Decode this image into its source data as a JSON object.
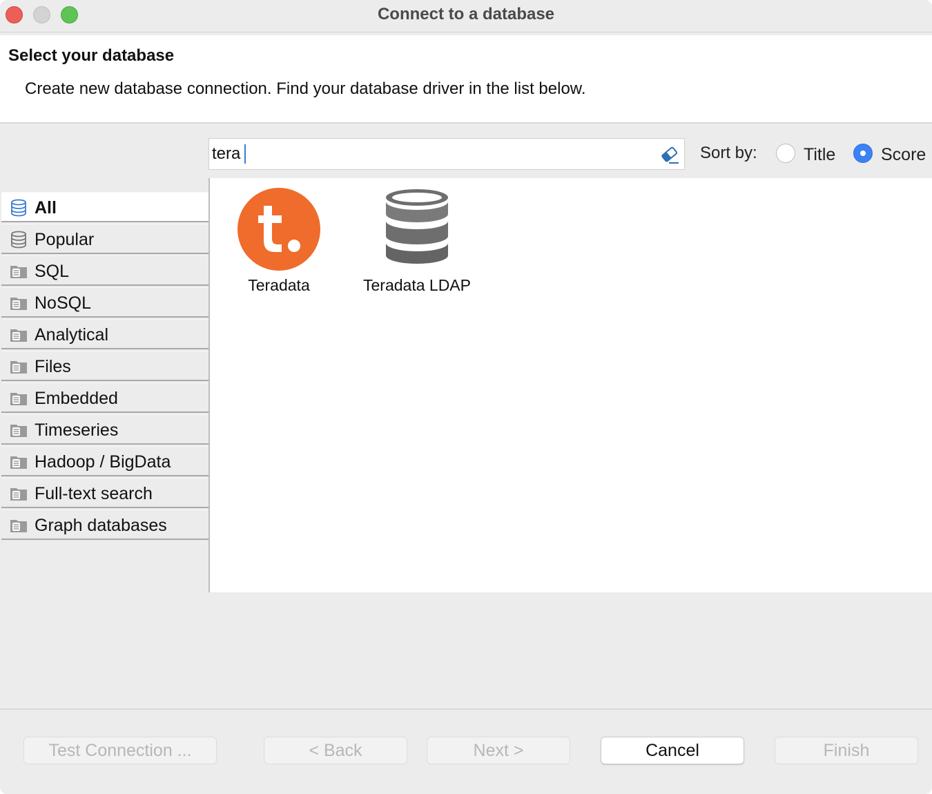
{
  "window": {
    "title": "Connect to a database"
  },
  "header": {
    "title": "Select your database",
    "description": "Create new database connection. Find your database driver in the list below."
  },
  "search": {
    "value": "tera"
  },
  "sort": {
    "label": "Sort by:",
    "options": [
      {
        "label": "Title",
        "selected": false
      },
      {
        "label": "Score",
        "selected": true
      }
    ]
  },
  "categories": [
    {
      "label": "All",
      "selected": true,
      "icon": "database-stack-icon"
    },
    {
      "label": "Popular",
      "selected": false,
      "icon": "database-stack-icon"
    },
    {
      "label": "SQL",
      "selected": false,
      "icon": "folder-database-icon"
    },
    {
      "label": "NoSQL",
      "selected": false,
      "icon": "folder-database-icon"
    },
    {
      "label": "Analytical",
      "selected": false,
      "icon": "folder-database-icon"
    },
    {
      "label": "Files",
      "selected": false,
      "icon": "folder-database-icon"
    },
    {
      "label": "Embedded",
      "selected": false,
      "icon": "folder-database-icon"
    },
    {
      "label": "Timeseries",
      "selected": false,
      "icon": "folder-database-icon"
    },
    {
      "label": "Hadoop / BigData",
      "selected": false,
      "icon": "folder-database-icon"
    },
    {
      "label": "Full-text search",
      "selected": false,
      "icon": "folder-database-icon"
    },
    {
      "label": "Graph databases",
      "selected": false,
      "icon": "folder-database-icon"
    }
  ],
  "drivers": [
    {
      "label": "Teradata",
      "icon": "teradata-logo-icon",
      "color": "#ef6c2c"
    },
    {
      "label": "Teradata LDAP",
      "icon": "database-stack-icon",
      "color": "#6e6e6e"
    }
  ],
  "buttons": {
    "test_connection": "Test Connection ...",
    "back": "< Back",
    "next": "Next >",
    "cancel": "Cancel",
    "finish": "Finish"
  }
}
